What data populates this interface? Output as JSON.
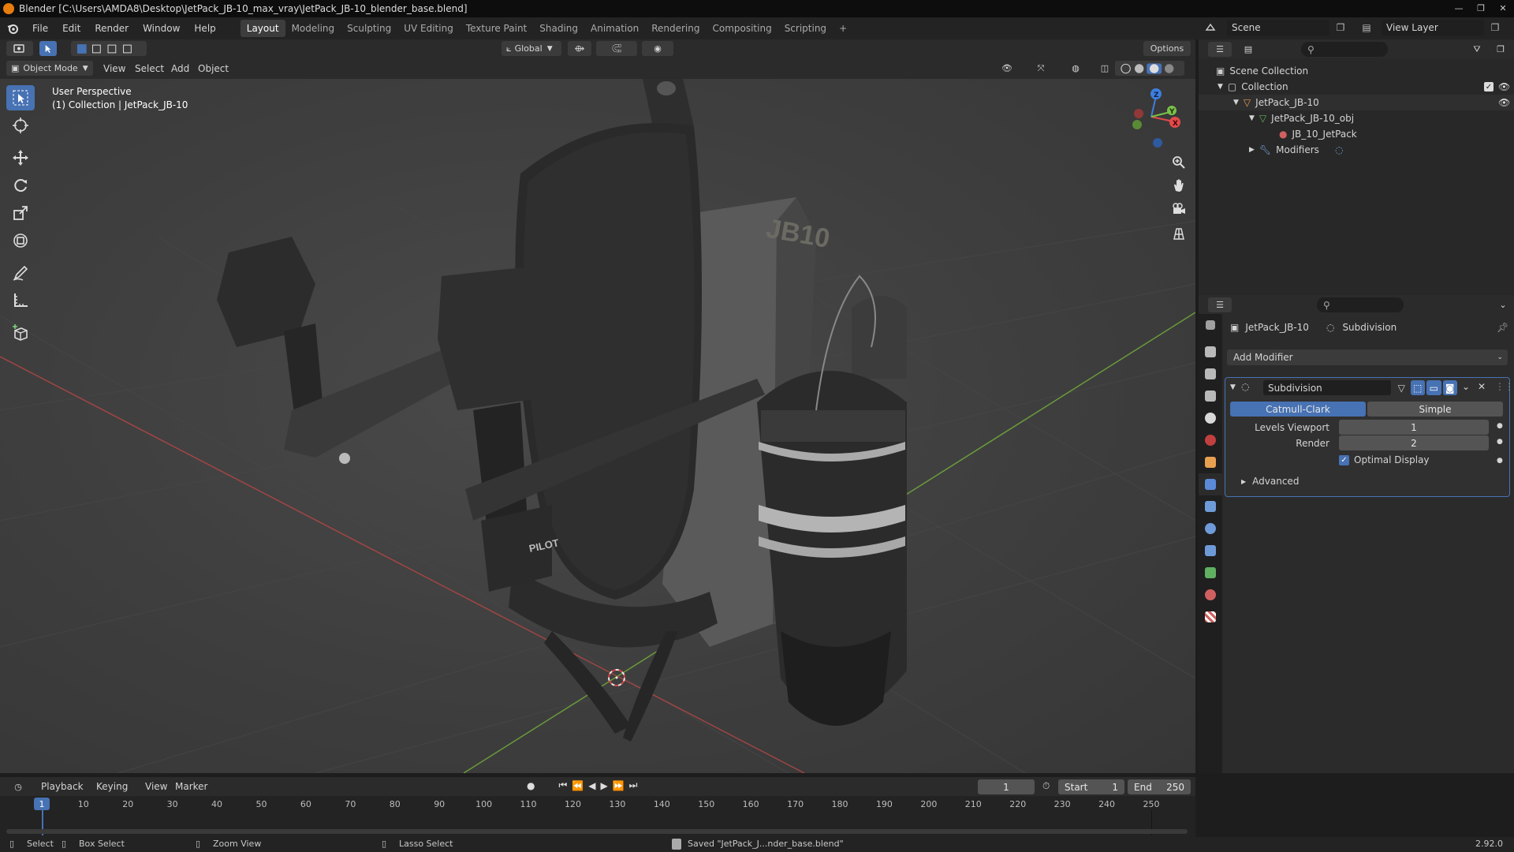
{
  "window": {
    "title": "Blender [C:\\Users\\AMDA8\\Desktop\\JetPack_JB-10_max_vray\\JetPack_JB-10_blender_base.blend]",
    "controls": [
      "—",
      "❐",
      "✕"
    ]
  },
  "menu": [
    "File",
    "Edit",
    "Render",
    "Window",
    "Help"
  ],
  "workspaces": [
    "Layout",
    "Modeling",
    "Sculpting",
    "UV Editing",
    "Texture Paint",
    "Shading",
    "Animation",
    "Rendering",
    "Compositing",
    "Scripting"
  ],
  "workspace_add": "+",
  "scene": {
    "name": "Scene",
    "view_layer": "View Layer"
  },
  "viewport_header": {
    "transform_orientation": "Global",
    "options": "Options",
    "mode": "Object Mode",
    "menus": [
      "View",
      "Select",
      "Add",
      "Object"
    ]
  },
  "viewport_overlay": {
    "line1": "User Perspective",
    "line2": "(1) Collection | JetPack_JB-10"
  },
  "gizmo": {
    "x": "X",
    "y": "Y",
    "z": "Z"
  },
  "outliner": {
    "search_placeholder": "",
    "rows": [
      {
        "label": "Scene Collection",
        "indent": 0
      },
      {
        "label": "Collection",
        "indent": 1
      },
      {
        "label": "JetPack_JB-10",
        "indent": 2
      },
      {
        "label": "JetPack_JB-10_obj",
        "indent": 3
      },
      {
        "label": "JB_10_JetPack",
        "indent": 4
      },
      {
        "label": "Modifiers",
        "indent": 3
      }
    ]
  },
  "properties": {
    "breadcrumb_object": "JetPack_JB-10",
    "breadcrumb_modifier": "Subdivision",
    "add_modifier": "Add Modifier",
    "modifier": {
      "name": "Subdivision",
      "type_options": [
        "Catmull-Clark",
        "Simple"
      ],
      "selected_type": "Catmull-Clark",
      "levels_viewport_label": "Levels Viewport",
      "levels_viewport": "1",
      "render_label": "Render",
      "render": "2",
      "optimal_display_label": "Optimal Display",
      "optimal_display": true,
      "advanced_label": "Advanced"
    }
  },
  "timeline": {
    "menus": [
      "Playback",
      "Keying",
      "View",
      "Marker"
    ],
    "current_frame": "1",
    "start_label": "Start",
    "start": "1",
    "end_label": "End",
    "end": "250",
    "ticks": [
      "1",
      "10",
      "20",
      "30",
      "40",
      "50",
      "60",
      "70",
      "80",
      "90",
      "100",
      "110",
      "120",
      "130",
      "140",
      "150",
      "160",
      "170",
      "180",
      "190",
      "200",
      "210",
      "220",
      "230",
      "240",
      "250"
    ]
  },
  "status": {
    "select": "Select",
    "box_select": "Box Select",
    "zoom_view": "Zoom View",
    "lasso_select": "Lasso Select",
    "message": "Saved \"JetPack_J...nder_base.blend\"",
    "version": "2.92.0"
  },
  "colors": {
    "accent": "#4772b3",
    "axis_x": "#e04b4b",
    "axis_y": "#7ac04a",
    "axis_z": "#3d7ee0"
  },
  "jetpack_labels": {
    "brand": "JB10",
    "pilot": "PILOT"
  }
}
